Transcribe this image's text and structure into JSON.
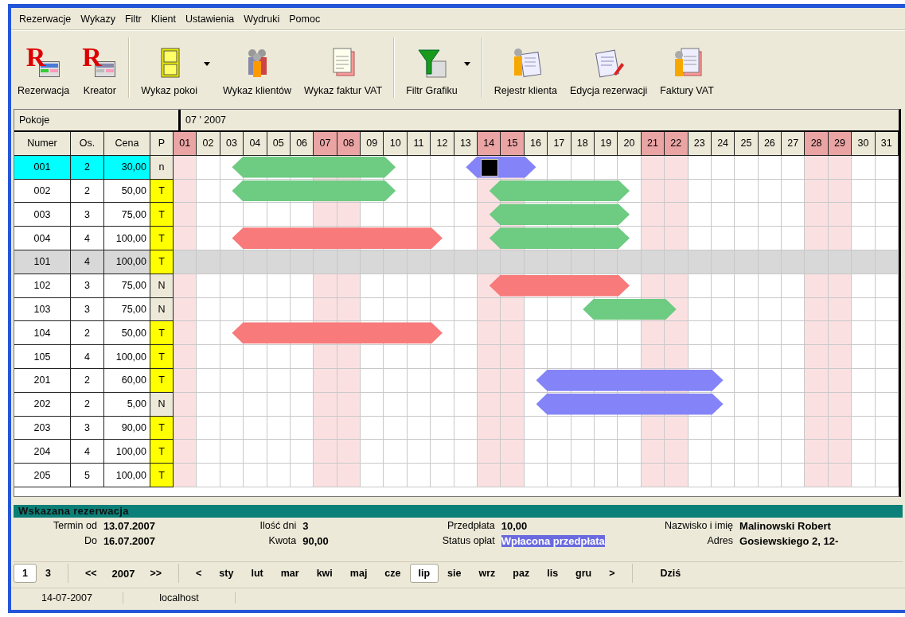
{
  "menu": [
    "Rezerwacje",
    "Wykazy",
    "Filtr",
    "Klient",
    "Ustawienia",
    "Wydruki",
    "Pomoc"
  ],
  "toolbar": [
    [
      {
        "label": "Rezerwacja",
        "logo_letter": "R",
        "dropdown": false
      },
      {
        "label": "Kreator",
        "logo_letter": "R",
        "dropdown": false
      }
    ],
    [
      {
        "label": "Wykaz pokoi",
        "dropdown": true
      },
      {
        "label": "Wykaz klientów",
        "dropdown": false
      },
      {
        "label": "Wykaz faktur VAT",
        "dropdown": false
      }
    ],
    [
      {
        "label": "Filtr Grafiku",
        "dropdown": true
      }
    ],
    [
      {
        "label": "Rejestr klienta",
        "dropdown": false
      },
      {
        "label": "Edycja rezerwacji",
        "dropdown": false
      },
      {
        "label": "Faktury VAT",
        "dropdown": false
      }
    ]
  ],
  "grid": {
    "rooms_title": "Pokoje",
    "period": "07 ' 2007",
    "columns": [
      "Numer",
      "Os.",
      "Cena",
      "P"
    ],
    "days": [
      {
        "label": "01",
        "weekend": true
      },
      {
        "label": "02",
        "weekend": false
      },
      {
        "label": "03",
        "weekend": false
      },
      {
        "label": "04",
        "weekend": false
      },
      {
        "label": "05",
        "weekend": false
      },
      {
        "label": "06",
        "weekend": false
      },
      {
        "label": "07",
        "weekend": true
      },
      {
        "label": "08",
        "weekend": true
      },
      {
        "label": "09",
        "weekend": false
      },
      {
        "label": "10",
        "weekend": false
      },
      {
        "label": "11",
        "weekend": false
      },
      {
        "label": "12",
        "weekend": false
      },
      {
        "label": "13",
        "weekend": false
      },
      {
        "label": "14",
        "weekend": true
      },
      {
        "label": "15",
        "weekend": true
      },
      {
        "label": "16",
        "weekend": false
      },
      {
        "label": "17",
        "weekend": false
      },
      {
        "label": "18",
        "weekend": false
      },
      {
        "label": "19",
        "weekend": false
      },
      {
        "label": "20",
        "weekend": false
      },
      {
        "label": "21",
        "weekend": true
      },
      {
        "label": "22",
        "weekend": true
      },
      {
        "label": "23",
        "weekend": false
      },
      {
        "label": "24",
        "weekend": false
      },
      {
        "label": "25",
        "weekend": false
      },
      {
        "label": "26",
        "weekend": false
      },
      {
        "label": "27",
        "weekend": false
      },
      {
        "label": "28",
        "weekend": true
      },
      {
        "label": "29",
        "weekend": true
      },
      {
        "label": "30",
        "weekend": false
      },
      {
        "label": "31",
        "weekend": false
      }
    ],
    "rows": [
      {
        "number": "001",
        "persons": "2",
        "price": "30,00",
        "p": "n",
        "p_highlight": false,
        "selected": true,
        "disabled": false,
        "bookings": [
          {
            "color": "#6dcb82",
            "selected": false
          },
          {
            "color": "#8484f8",
            "selected": true
          }
        ]
      },
      {
        "number": "002",
        "persons": "2",
        "price": "50,00",
        "p": "T",
        "p_highlight": true,
        "selected": false,
        "disabled": false,
        "bookings": [
          {
            "color": "#6dcb82",
            "selected": false
          },
          {
            "color": "#6dcb82",
            "selected": false
          }
        ]
      },
      {
        "number": "003",
        "persons": "3",
        "price": "75,00",
        "p": "T",
        "p_highlight": true,
        "selected": false,
        "disabled": false,
        "bookings": [
          {
            "color": "#6dcb82",
            "selected": false
          }
        ]
      },
      {
        "number": "004",
        "persons": "4",
        "price": "100,00",
        "p": "T",
        "p_highlight": true,
        "selected": false,
        "disabled": false,
        "bookings": [
          {
            "color": "#f87a7a",
            "selected": false
          },
          {
            "color": "#6dcb82",
            "selected": false
          }
        ]
      },
      {
        "number": "101",
        "persons": "4",
        "price": "100,00",
        "p": "T",
        "p_highlight": true,
        "selected": false,
        "disabled": true
      },
      {
        "number": "102",
        "persons": "3",
        "price": "75,00",
        "p": "N",
        "p_highlight": false,
        "selected": false,
        "disabled": false,
        "bookings": [
          {
            "color": "#f87a7a",
            "selected": false
          }
        ]
      },
      {
        "number": "103",
        "persons": "3",
        "price": "75,00",
        "p": "N",
        "p_highlight": false,
        "selected": false,
        "disabled": false,
        "bookings": [
          {
            "color": "#6dcb82",
            "selected": false
          }
        ]
      },
      {
        "number": "104",
        "persons": "2",
        "price": "50,00",
        "p": "T",
        "p_highlight": true,
        "selected": false,
        "disabled": false,
        "bookings": [
          {
            "color": "#f87a7a",
            "selected": false
          }
        ]
      },
      {
        "number": "105",
        "persons": "4",
        "price": "100,00",
        "p": "T",
        "p_highlight": true,
        "selected": false,
        "disabled": false
      },
      {
        "number": "201",
        "persons": "2",
        "price": "60,00",
        "p": "T",
        "p_highlight": true,
        "selected": false,
        "disabled": false,
        "bookings": [
          {
            "color": "#8484f8",
            "selected": false
          }
        ]
      },
      {
        "number": "202",
        "persons": "2",
        "price": "5,00",
        "p": "N",
        "p_highlight": false,
        "selected": false,
        "disabled": false,
        "bookings": [
          {
            "color": "#8484f8",
            "selected": false
          }
        ]
      },
      {
        "number": "203",
        "persons": "3",
        "price": "90,00",
        "p": "T",
        "p_highlight": true,
        "selected": false,
        "disabled": false
      },
      {
        "number": "204",
        "persons": "4",
        "price": "100,00",
        "p": "T",
        "p_highlight": true,
        "selected": false,
        "disabled": false
      },
      {
        "number": "205",
        "persons": "5",
        "price": "100,00",
        "p": "T",
        "p_highlight": true,
        "selected": false,
        "disabled": false
      }
    ]
  },
  "details": {
    "title": "Wskazana rezerwacja",
    "columns": [
      [
        {
          "label": "Termin od",
          "value": "13.07.2007",
          "highlight": false
        },
        {
          "label": "Do",
          "value": "16.07.2007",
          "highlight": false
        }
      ],
      [
        {
          "label": "Ilość dni",
          "value": "3",
          "highlight": false
        },
        {
          "label": "Kwota",
          "value": "90,00",
          "highlight": false
        }
      ],
      [
        {
          "label": "Przedpłata",
          "value": "10,00",
          "highlight": false
        },
        {
          "label": "Status opłat",
          "value": "Wpłacona przedpłata",
          "highlight": true
        }
      ],
      [
        {
          "label": "Nazwisko i imię",
          "value": "Malinowski Robert",
          "highlight": false
        },
        {
          "label": "Adres",
          "value": "Gosiewskiego 2, 12-",
          "highlight": false
        }
      ]
    ]
  },
  "navigator": {
    "pages": [
      {
        "label": "1",
        "selected": true
      },
      {
        "label": "3",
        "selected": false
      }
    ],
    "year": {
      "prev": "<<",
      "value": "2007",
      "next": ">>"
    },
    "months": {
      "prev": "<",
      "next": ">",
      "items": [
        {
          "label": "sty",
          "selected": false
        },
        {
          "label": "lut",
          "selected": false
        },
        {
          "label": "mar",
          "selected": false
        },
        {
          "label": "kwi",
          "selected": false
        },
        {
          "label": "maj",
          "selected": false
        },
        {
          "label": "cze",
          "selected": false
        },
        {
          "label": "lip",
          "selected": true
        },
        {
          "label": "sie",
          "selected": false
        },
        {
          "label": "wrz",
          "selected": false
        },
        {
          "label": "paz",
          "selected": false
        },
        {
          "label": "lis",
          "selected": false
        },
        {
          "label": "gru",
          "selected": false
        }
      ]
    },
    "today": "Dziś"
  },
  "status_bar": [
    "14-07-2007",
    "localhost"
  ]
}
